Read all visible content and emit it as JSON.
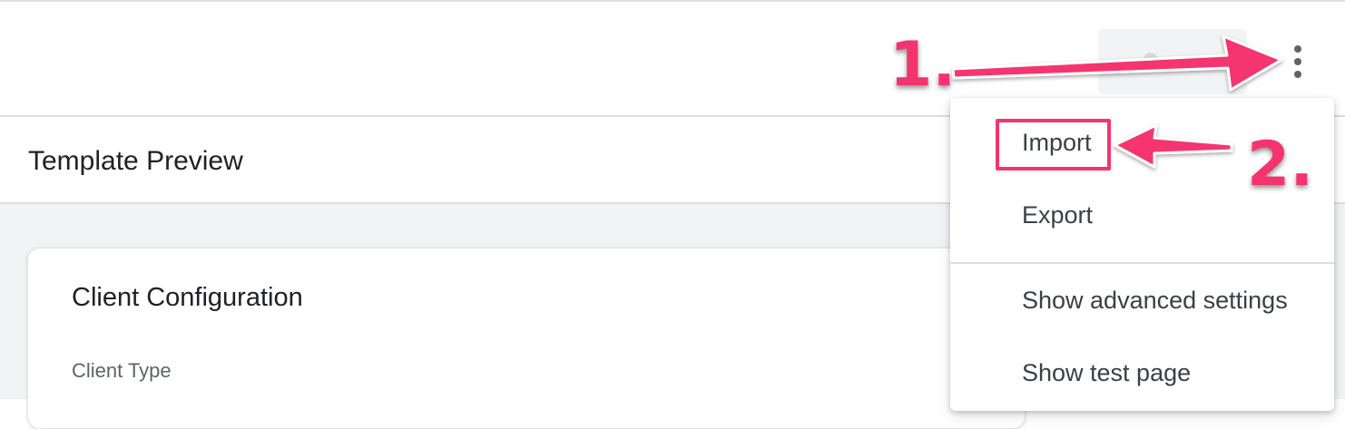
{
  "header": {
    "more_icon": "more-vert-icon"
  },
  "page": {
    "title": "Template Preview"
  },
  "card": {
    "title": "Client Configuration",
    "field_label": "Client Type"
  },
  "menu": {
    "items": [
      {
        "label": "Import"
      },
      {
        "label": "Export"
      },
      {
        "label": "Show advanced settings"
      },
      {
        "label": "Show test page"
      }
    ]
  },
  "annotations": {
    "step1": "1.",
    "step2": "2.",
    "color": "#f4346f"
  }
}
